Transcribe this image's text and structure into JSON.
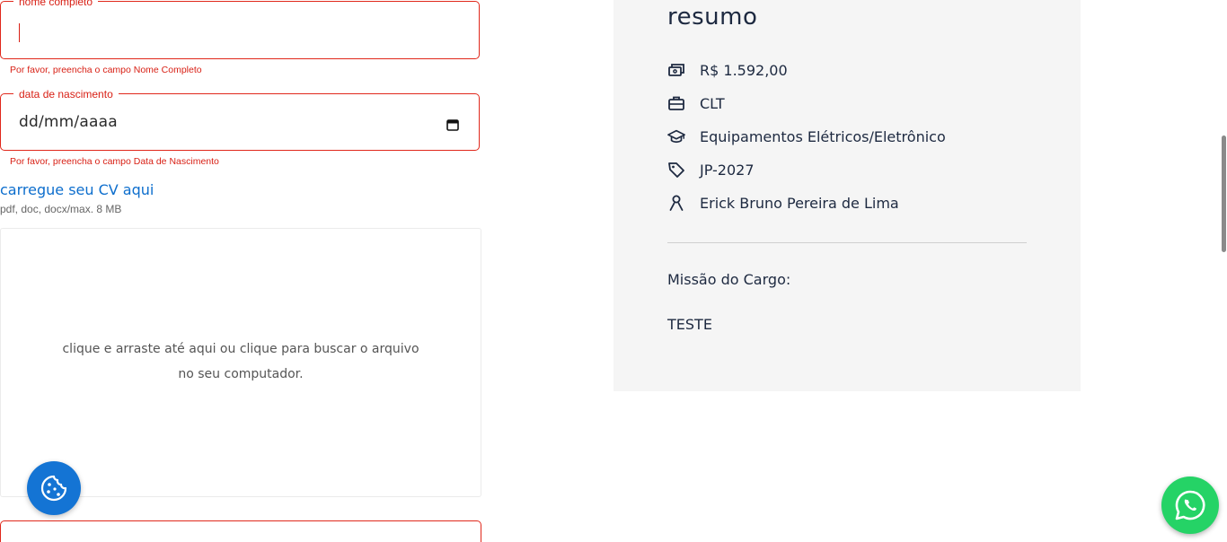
{
  "form": {
    "full_name": {
      "legend": "nome completo",
      "value": "",
      "error": "Por favor, preencha o campo Nome Completo"
    },
    "birth_date": {
      "legend": "data de nascimento",
      "placeholder": "dd/mm/aaaa",
      "error": "Por favor, preencha o campo Data de Nascimento"
    },
    "cv_upload": {
      "title": "carregue seu CV aqui",
      "hint": "pdf, doc, docx/max. 8 MB",
      "dropzone_text": "clique e arraste até aqui ou clique para buscar o arquivo no seu computador."
    }
  },
  "summary": {
    "title": "resumo",
    "items": [
      {
        "icon": "money-icon",
        "label": "R$ 1.592,00"
      },
      {
        "icon": "briefcase-icon",
        "label": "CLT"
      },
      {
        "icon": "graduation-cap-icon",
        "label": "Equipamentos Elétricos/Eletrônico"
      },
      {
        "icon": "tag-icon",
        "label": "JP-2027"
      },
      {
        "icon": "person-icon",
        "label": "Erick Bruno Pereira de Lima"
      }
    ],
    "mission_label": "Missão do Cargo:",
    "mission_value": "TESTE"
  },
  "colors": {
    "error": "#d81f14",
    "link": "#0d6ecd",
    "cookie_button": "#1474d4",
    "whatsapp": "#25d366",
    "summary_bg": "#f5f5f5",
    "summary_text": "#1d2940"
  }
}
